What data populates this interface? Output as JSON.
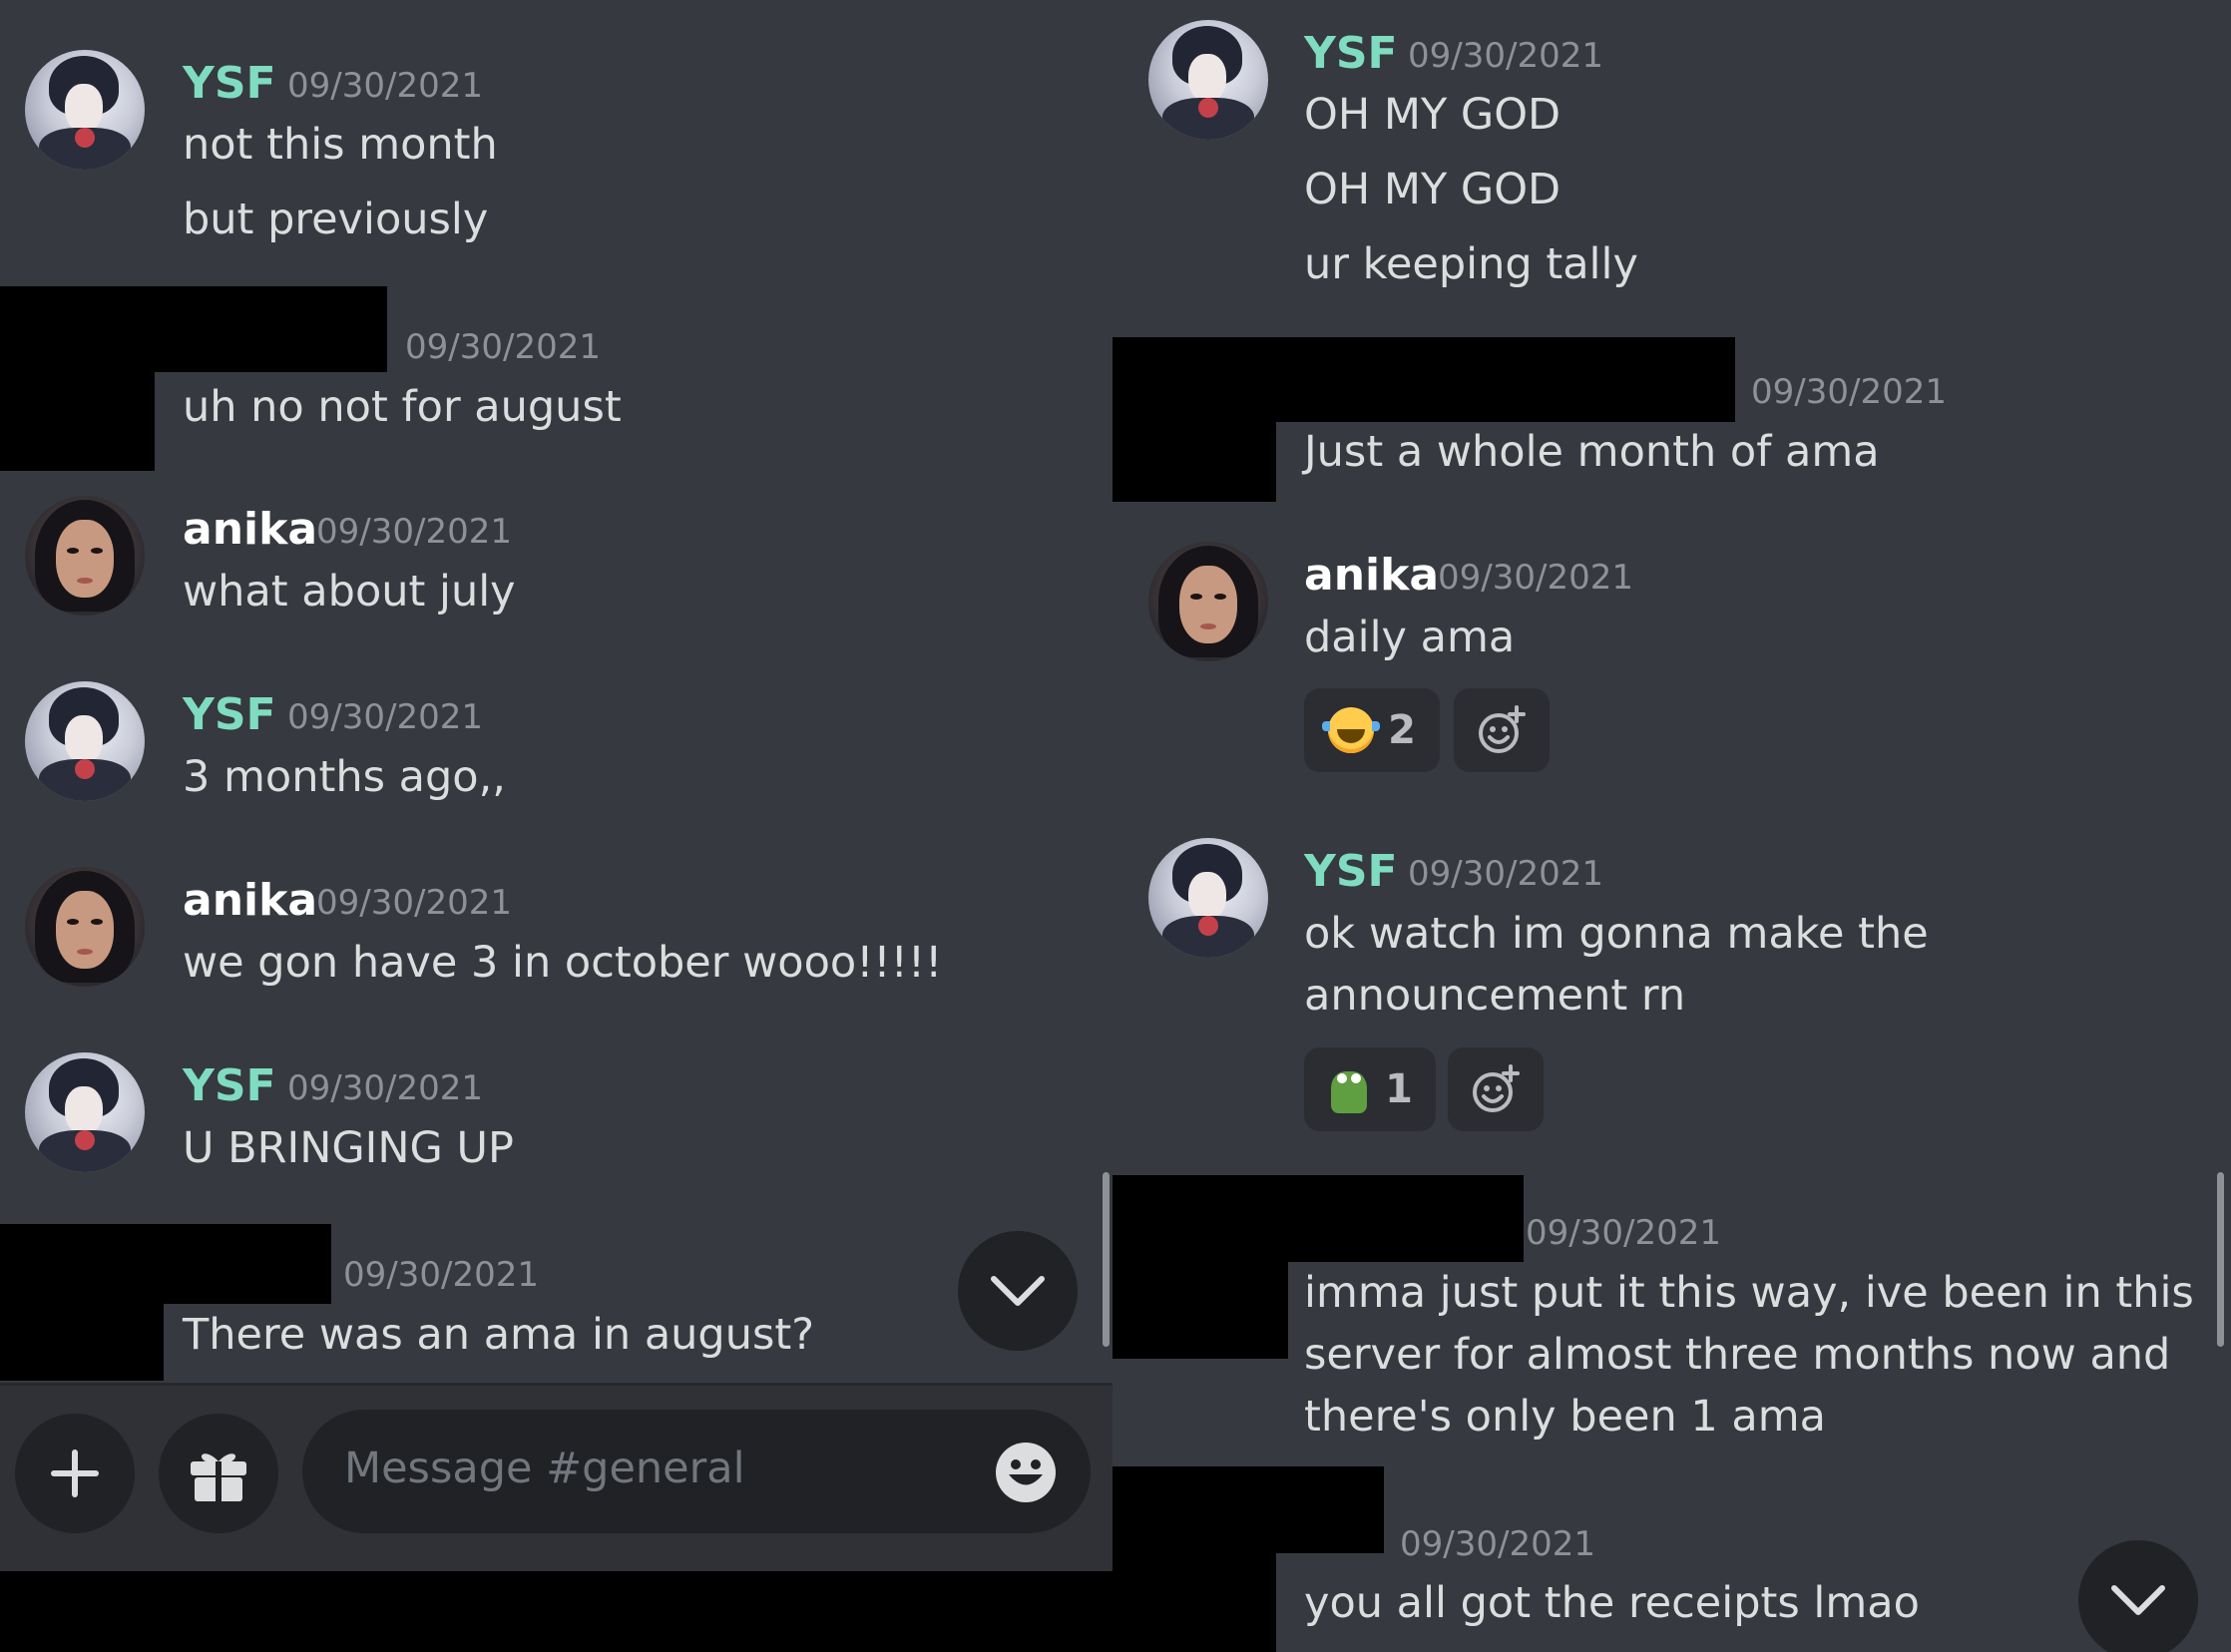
{
  "left": {
    "messages": [
      {
        "author": "YSF",
        "time": "09/30/2021",
        "lines": [
          "not this month",
          "but previously"
        ]
      },
      {
        "author": "",
        "time": "09/30/2021",
        "lines": [
          "uh no not for august"
        ]
      },
      {
        "author": "anika",
        "time": "09/30/2021",
        "lines": [
          "what about july"
        ]
      },
      {
        "author": "YSF",
        "time": "09/30/2021",
        "lines": [
          "3 months ago,,"
        ]
      },
      {
        "author": "anika",
        "time": "09/30/2021",
        "lines": [
          "we gon have 3 in october wooo!!!!!"
        ]
      },
      {
        "author": "YSF",
        "time": "09/30/2021",
        "lines": [
          "U BRINGING UP"
        ]
      },
      {
        "author": "",
        "time": "09/30/2021",
        "lines": [
          "There was an ama in august?"
        ]
      }
    ],
    "composer": {
      "placeholder": "Message #general"
    }
  },
  "right": {
    "messages": [
      {
        "author": "YSF",
        "time": "09/30/2021",
        "lines": [
          "OH MY GOD",
          "OH MY GOD",
          "ur keeping tally"
        ]
      },
      {
        "author": "",
        "time": "09/30/2021",
        "lines": [
          "Just a whole month of ama"
        ]
      },
      {
        "author": "anika",
        "time": "09/30/2021",
        "lines": [
          "daily ama"
        ],
        "reactions": [
          {
            "emoji": "joy-emoji",
            "count": "2"
          }
        ]
      },
      {
        "author": "YSF",
        "time": "09/30/2021",
        "lines": [
          "ok watch im gonna make the announcement rn"
        ],
        "reactions": [
          {
            "emoji": "pepe-frog-emoji",
            "count": "1"
          }
        ]
      },
      {
        "author": "",
        "time": "09/30/2021",
        "lines": [
          "imma just put it this way, ive been in this server for almost three months now and there's only been 1 ama"
        ]
      },
      {
        "author": "",
        "time": "09/30/2021",
        "lines": [
          "you all got the receipts lmao"
        ]
      }
    ]
  },
  "colors": {
    "background": "#36393f",
    "ysf_name": "#7fdcc0",
    "timestamp": "#8e9297",
    "message_text": "#dcddde",
    "composer_bg": "#2f3136",
    "input_bg": "#202225"
  },
  "icons": [
    "plus-icon",
    "gift-icon",
    "emoji-icon",
    "chevron-down-icon",
    "add-reaction-icon"
  ]
}
